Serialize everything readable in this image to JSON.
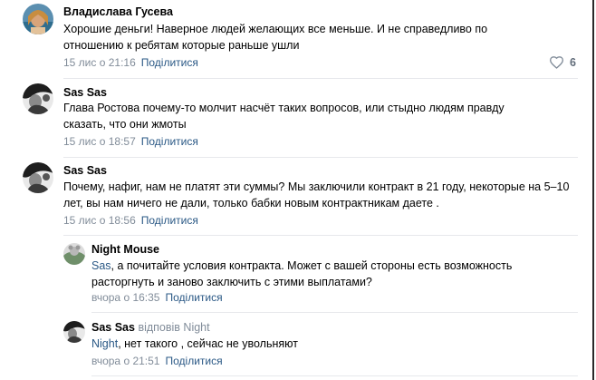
{
  "comments": [
    {
      "author": "Владислава Гусева",
      "text": "Хорошие деньги! Наверное людей желающих все меньше. И не справедливо по отношению к ребятам которые раньше ушли",
      "time": "15 лис о 21:16",
      "share": "Поділитися",
      "likes": "6"
    },
    {
      "author": "Sas Sas",
      "text": "Глава Ростова почему-то молчит насчёт таких вопросов, или стыдно людям правду сказать, что они жмоты",
      "time": "15 лис о 18:57",
      "share": "Поділитися"
    },
    {
      "author": "Sas Sas",
      "text": "Почему, нафиг, нам не платят эти суммы? Мы заключили контракт в 21 году, некоторые на 5–10 лет, вы нам ничего не дали, только бабки новым контрактникам даете .",
      "time": "15 лис о 18:56",
      "share": "Поділитися"
    }
  ],
  "replies": [
    {
      "author": "Night Mouse",
      "mention": "Sas",
      "text": ", а почитайте условия контракта. Может с вашей стороны есть возможность расторгнуть и заново заключить с этими выплатами?",
      "time": "вчора о 16:35",
      "share": "Поділитися"
    },
    {
      "author": "Sas Sas",
      "reply_to": "відповів Night",
      "mention": "Night",
      "text": ", нет такого , сейчас не увольняют",
      "time": "вчора о 21:51",
      "share": "Поділитися"
    }
  ],
  "icons": {
    "like": "heart-icon"
  },
  "colors": {
    "link": "#2a5885",
    "meta": "#818c99",
    "divider": "#e7e8ec"
  }
}
